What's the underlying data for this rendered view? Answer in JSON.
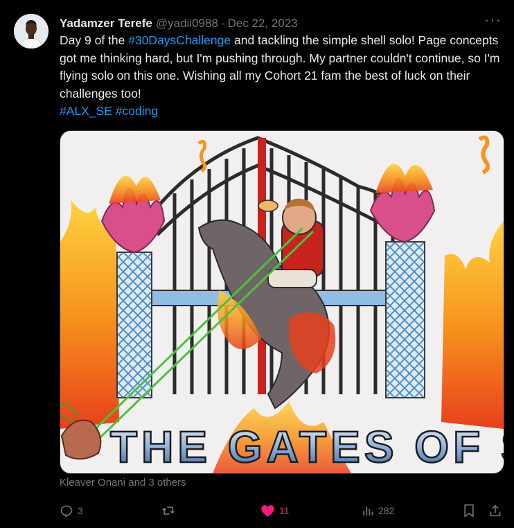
{
  "tweet": {
    "author_name": "Yadamzer Terefe",
    "author_handle": "@yadii0988",
    "separator": "·",
    "date": "Dec 22, 2023",
    "more_label": "···",
    "text_1": "Day 9 of the ",
    "hashtag_1": "#30DaysChallenge",
    "text_2": " and tackling the simple shell solo!  Page concepts got me thinking hard, but I'm pushing through. My partner couldn't continue, so I'm flying solo on this one.  Wishing all my Cohort 21 fam the best of luck on their challenges too!",
    "hashtag_2": "#ALX_SE",
    "hashtag_3": "#coding",
    "media_text": "THE GATES OF SHELL",
    "liked_by": "Kleaver Onani and 3 others"
  },
  "actions": {
    "reply_count": "3",
    "repost_count": "",
    "like_count": "11",
    "views_count": "282",
    "like_liked": true
  },
  "colors": {
    "background": "#000000",
    "text": "#e7e9ea",
    "muted": "#71767b",
    "link": "#1d9bf0",
    "like": "#f91880"
  },
  "icons": [
    "reply-icon",
    "repost-icon",
    "heart-icon",
    "views-icon",
    "bookmark-icon",
    "share-icon",
    "more-icon"
  ]
}
